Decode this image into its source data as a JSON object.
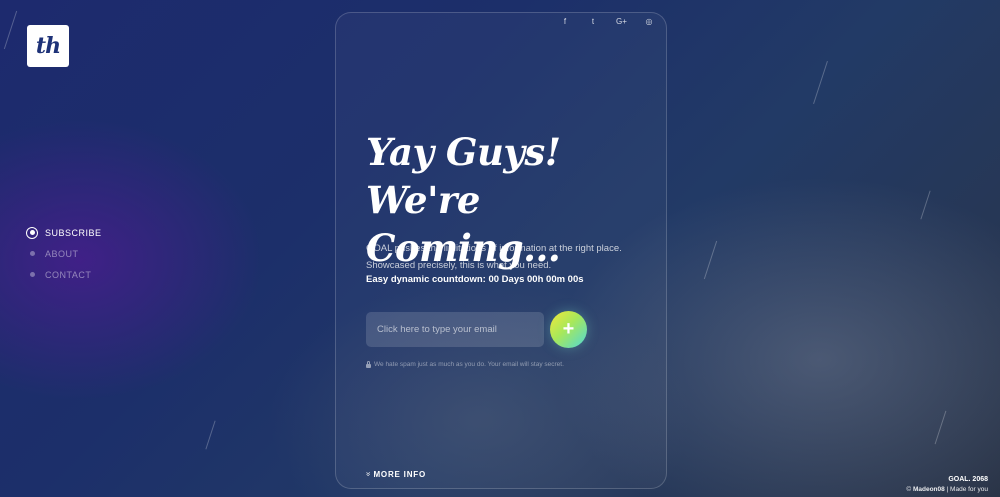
{
  "logo": {
    "text": "th"
  },
  "side_nav": [
    {
      "label": "SUBSCRIBE",
      "active": true
    },
    {
      "label": "ABOUT",
      "active": false
    },
    {
      "label": "CONTACT",
      "active": false
    }
  ],
  "social": [
    {
      "icon": "facebook-icon",
      "glyph": "f"
    },
    {
      "icon": "twitter-icon",
      "glyph": "t"
    },
    {
      "icon": "google-plus-icon",
      "glyph": "G+"
    },
    {
      "icon": "instagram-icon",
      "glyph": "◎"
    }
  ],
  "hero": {
    "line1": "Yay Guys!",
    "line2": "We're Coming...",
    "description": "GOAL pushes the limitations of information at the right place. Showcased precisely, this is what you need.",
    "countdown": "Easy dynamic countdown: 00 Days 00h 00m 00s"
  },
  "subscribe": {
    "placeholder": "Click here to type your email",
    "button_label": "+",
    "spam_note": "We hate spam just as much as you do. Your email will stay secret."
  },
  "more_info": {
    "label": "MORE INFO",
    "glyph": "»"
  },
  "footer": {
    "brand": "GOAL. 2068",
    "copyright_prefix": "© ",
    "author": "Madeon08",
    "copyright_suffix": " | Made for you"
  },
  "colors": {
    "accent_start": "#f3e73a",
    "accent_end": "#4fd7d7",
    "background": "#1d2a6e"
  }
}
